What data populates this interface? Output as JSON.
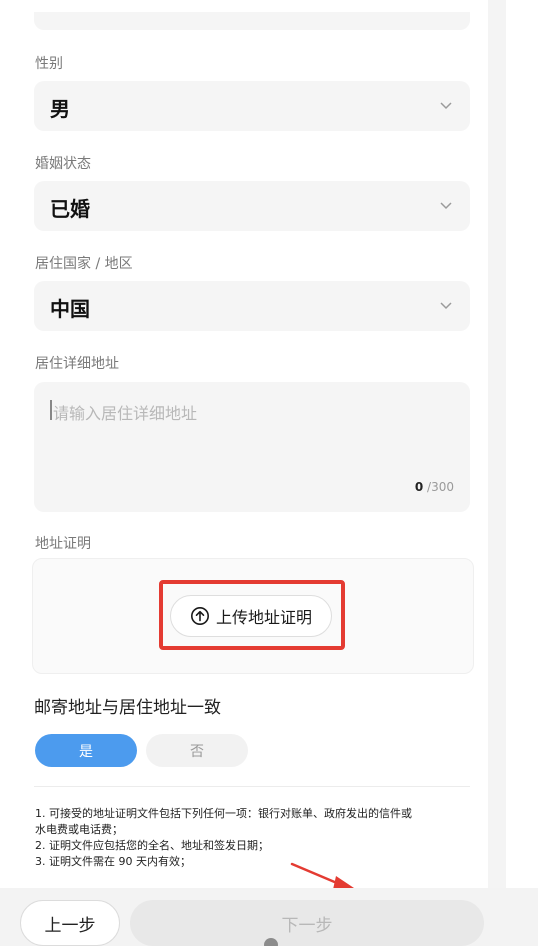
{
  "gender": {
    "label": "性别",
    "value": "男"
  },
  "marital": {
    "label": "婚姻状态",
    "value": "已婚"
  },
  "country": {
    "label": "居住国家 / 地区",
    "value": "中国"
  },
  "address": {
    "label": "居住详细地址",
    "placeholder": "请输入居住详细地址",
    "count": "0",
    "max": " /300"
  },
  "proof": {
    "label": "地址证明",
    "upload_label": "上传地址证明"
  },
  "mailing": {
    "question": "邮寄地址与居住地址一致",
    "yes": "是",
    "no": "否"
  },
  "notes": [
    "1. 可接受的地址证明文件包括下列任何一项：银行对账单、政府发出的信件或",
    "水电费或电话费；",
    "2. 证明文件应包括您的全名、地址和签发日期；",
    "3. 证明文件需在 90 天内有效；"
  ],
  "footer": {
    "prev": "上一步",
    "next": "下一步"
  },
  "colors": {
    "accent": "#4c9bee",
    "highlight": "#e43b32"
  }
}
